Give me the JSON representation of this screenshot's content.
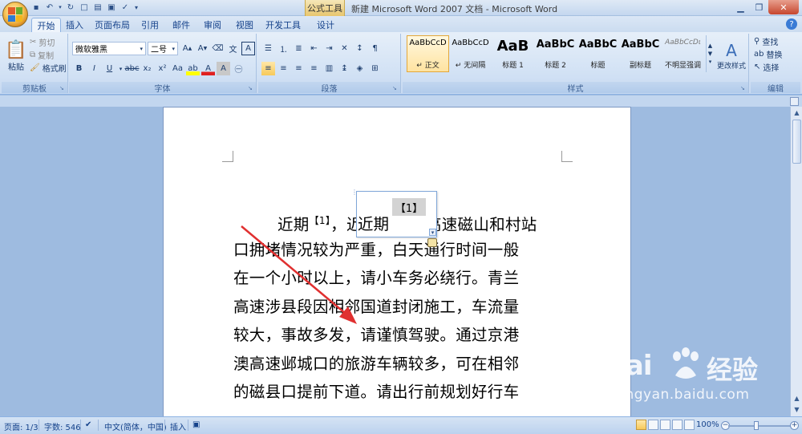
{
  "window": {
    "context_tool": "公式工具",
    "title": "新建 Microsoft Word 2007 文档 - Microsoft Word"
  },
  "tabs": [
    "开始",
    "插入",
    "页面布局",
    "引用",
    "邮件",
    "审阅",
    "视图",
    "开发工具",
    "设计"
  ],
  "active_tab": "开始",
  "ribbon": {
    "clipboard": {
      "label": "剪贴板",
      "paste": "粘贴",
      "cut": "剪切",
      "copy": "复制",
      "format_painter": "格式刷"
    },
    "font": {
      "label": "字体",
      "font_name": "微软雅黑",
      "font_size": "二号"
    },
    "paragraph": {
      "label": "段落"
    },
    "styles": {
      "label": "样式",
      "items": [
        {
          "sample": "AaBbCcD",
          "name": "↵ 正文"
        },
        {
          "sample": "AaBbCcD",
          "name": "↵ 无间隔"
        },
        {
          "sample": "AaB",
          "name": "标题 1"
        },
        {
          "sample": "AaBbC",
          "name": "标题 2"
        },
        {
          "sample": "AaBbC",
          "name": "标题"
        },
        {
          "sample": "AaBbC",
          "name": "副标题"
        },
        {
          "sample": "AaBbCcDι",
          "name": "不明显强调"
        }
      ],
      "change_styles": "更改样式"
    },
    "editing": {
      "label": "编辑",
      "find": "查找",
      "replace": "替换",
      "select": "选择"
    }
  },
  "document": {
    "footnote_marker": "【1】",
    "popup_marker": "【1】",
    "popup_text": "近期",
    "lines": [
      {
        "pre": "近期",
        "sup": "【1】",
        "post": "，近期　　　高速磁山和村站"
      },
      {
        "text": "口拥堵情况较为严重，白天通行时间一般"
      },
      {
        "text": "在一个小时以上，请小车务必绕行。青兰"
      },
      {
        "text": "高速涉县段因相邻国道封闭施工，车流量"
      },
      {
        "text": "较大，事故多发，请谨慎驾驶。通过京港"
      },
      {
        "text": "澳高速邺城口的旅游车辆较多，可在相邻"
      },
      {
        "text": "的磁县口提前下道。请出行前规划好行车"
      }
    ]
  },
  "statusbar": {
    "page": "页面: 1/3",
    "words": "字数: 546",
    "language": "中文(简体，中国)",
    "mode": "插入",
    "zoom": "100%"
  },
  "watermark": {
    "logo": "Bai",
    "logo_cn": "经验",
    "url": "jingyan.baidu.com"
  },
  "colors": {
    "arrow": "#e03030",
    "ribbon_bg": "#d4e3f5",
    "doc_bg": "#9ebbe0"
  }
}
